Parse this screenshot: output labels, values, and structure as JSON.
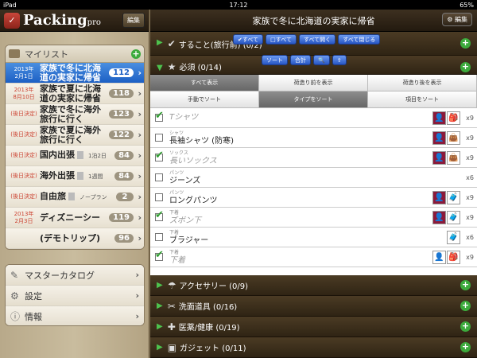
{
  "status": {
    "device": "iPad",
    "time": "17:12",
    "battery": "65%"
  },
  "sidebar": {
    "app_name": "Packing",
    "app_suffix": "pro",
    "edit_label": "編集",
    "mylist_title": "マイリスト",
    "trips": [
      {
        "date": "2013年\n2月1日",
        "name": "家族で冬に北海道の実家に帰省",
        "count": "112",
        "selected": true
      },
      {
        "date": "2013年\n8月10日",
        "name": "家族で夏に北海道の実家に帰省",
        "count": "118"
      },
      {
        "date": "(後日決定)",
        "name": "家族で冬に海外旅行に行く",
        "count": "123"
      },
      {
        "date": "(後日決定)",
        "name": "家族で夏に海外旅行に行く",
        "count": "122"
      },
      {
        "date": "(後日決定)",
        "name": "国内出張",
        "sub": "1泊2日",
        "count": "84"
      },
      {
        "date": "(後日決定)",
        "name": "海外出張",
        "sub": "1週間",
        "count": "84"
      },
      {
        "date": "(後日決定)",
        "name": "自由旅",
        "sub": "ノープラン",
        "count": "2"
      },
      {
        "date": "2013年\n2月3日",
        "name": "ディズニーシー",
        "count": "119"
      },
      {
        "date": "",
        "name": "(デモトリップ)",
        "count": "96"
      }
    ],
    "menu": [
      {
        "icon": "pen-icon",
        "label": "マスターカタログ"
      },
      {
        "icon": "gear-icon",
        "label": "設定"
      },
      {
        "icon": "info-icon",
        "label": "情報"
      }
    ]
  },
  "main": {
    "title": "家族で冬に北海道の実家に帰省",
    "settings_label": "編集",
    "bulk_buttons": [
      "✔すべて",
      "□すべて",
      "すべて開く",
      "すべて閉じる"
    ],
    "tool_buttons": [
      "ソート",
      "合計"
    ],
    "cat_todo": "すること(旅行前) (0/2)",
    "cat_required": "必須 (0/14)",
    "seg_row1": [
      "すべて表示",
      "荷造り前を表示",
      "荷造り後を表示"
    ],
    "seg_row2": [
      "手動でソート",
      "タイプをソート",
      "項目をソート"
    ],
    "items": [
      {
        "sub": "",
        "name": "Tシャツ",
        "checked": true,
        "people": [
          "m",
          "bag"
        ],
        "qty": "x9"
      },
      {
        "sub": "シャツ",
        "name": "長袖シャツ (防寒)",
        "checked": false,
        "people": [
          "m",
          "bag2"
        ],
        "qty": "x9"
      },
      {
        "sub": "ソックス",
        "name": "長いソックス",
        "checked": true,
        "people": [
          "m",
          "bag2"
        ],
        "qty": "x9"
      },
      {
        "sub": "パンツ",
        "name": "ジーンズ",
        "checked": false,
        "people": [],
        "qty": "x6"
      },
      {
        "sub": "パンツ",
        "name": "ロングパンツ",
        "checked": false,
        "people": [
          "m",
          "sc"
        ],
        "qty": "x9"
      },
      {
        "sub": "下着",
        "name": "ズボン下",
        "checked": true,
        "people": [
          "m",
          "sc"
        ],
        "qty": "x9"
      },
      {
        "sub": "下着",
        "name": "ブラジャー",
        "checked": false,
        "people": [
          "sc"
        ],
        "qty": "x6"
      },
      {
        "sub": "下着",
        "name": "下着",
        "checked": true,
        "people": [
          "f",
          "bag"
        ],
        "qty": "x9"
      }
    ],
    "categories": [
      {
        "icon": "umbrella-icon",
        "label": "アクセサリー (0/9)"
      },
      {
        "icon": "toiletries-icon",
        "label": "洗面道具 (0/16)"
      },
      {
        "icon": "medical-icon",
        "label": "医薬/健康 (0/19)"
      },
      {
        "icon": "gadget-icon",
        "label": "ガジェット (0/11)"
      }
    ]
  }
}
